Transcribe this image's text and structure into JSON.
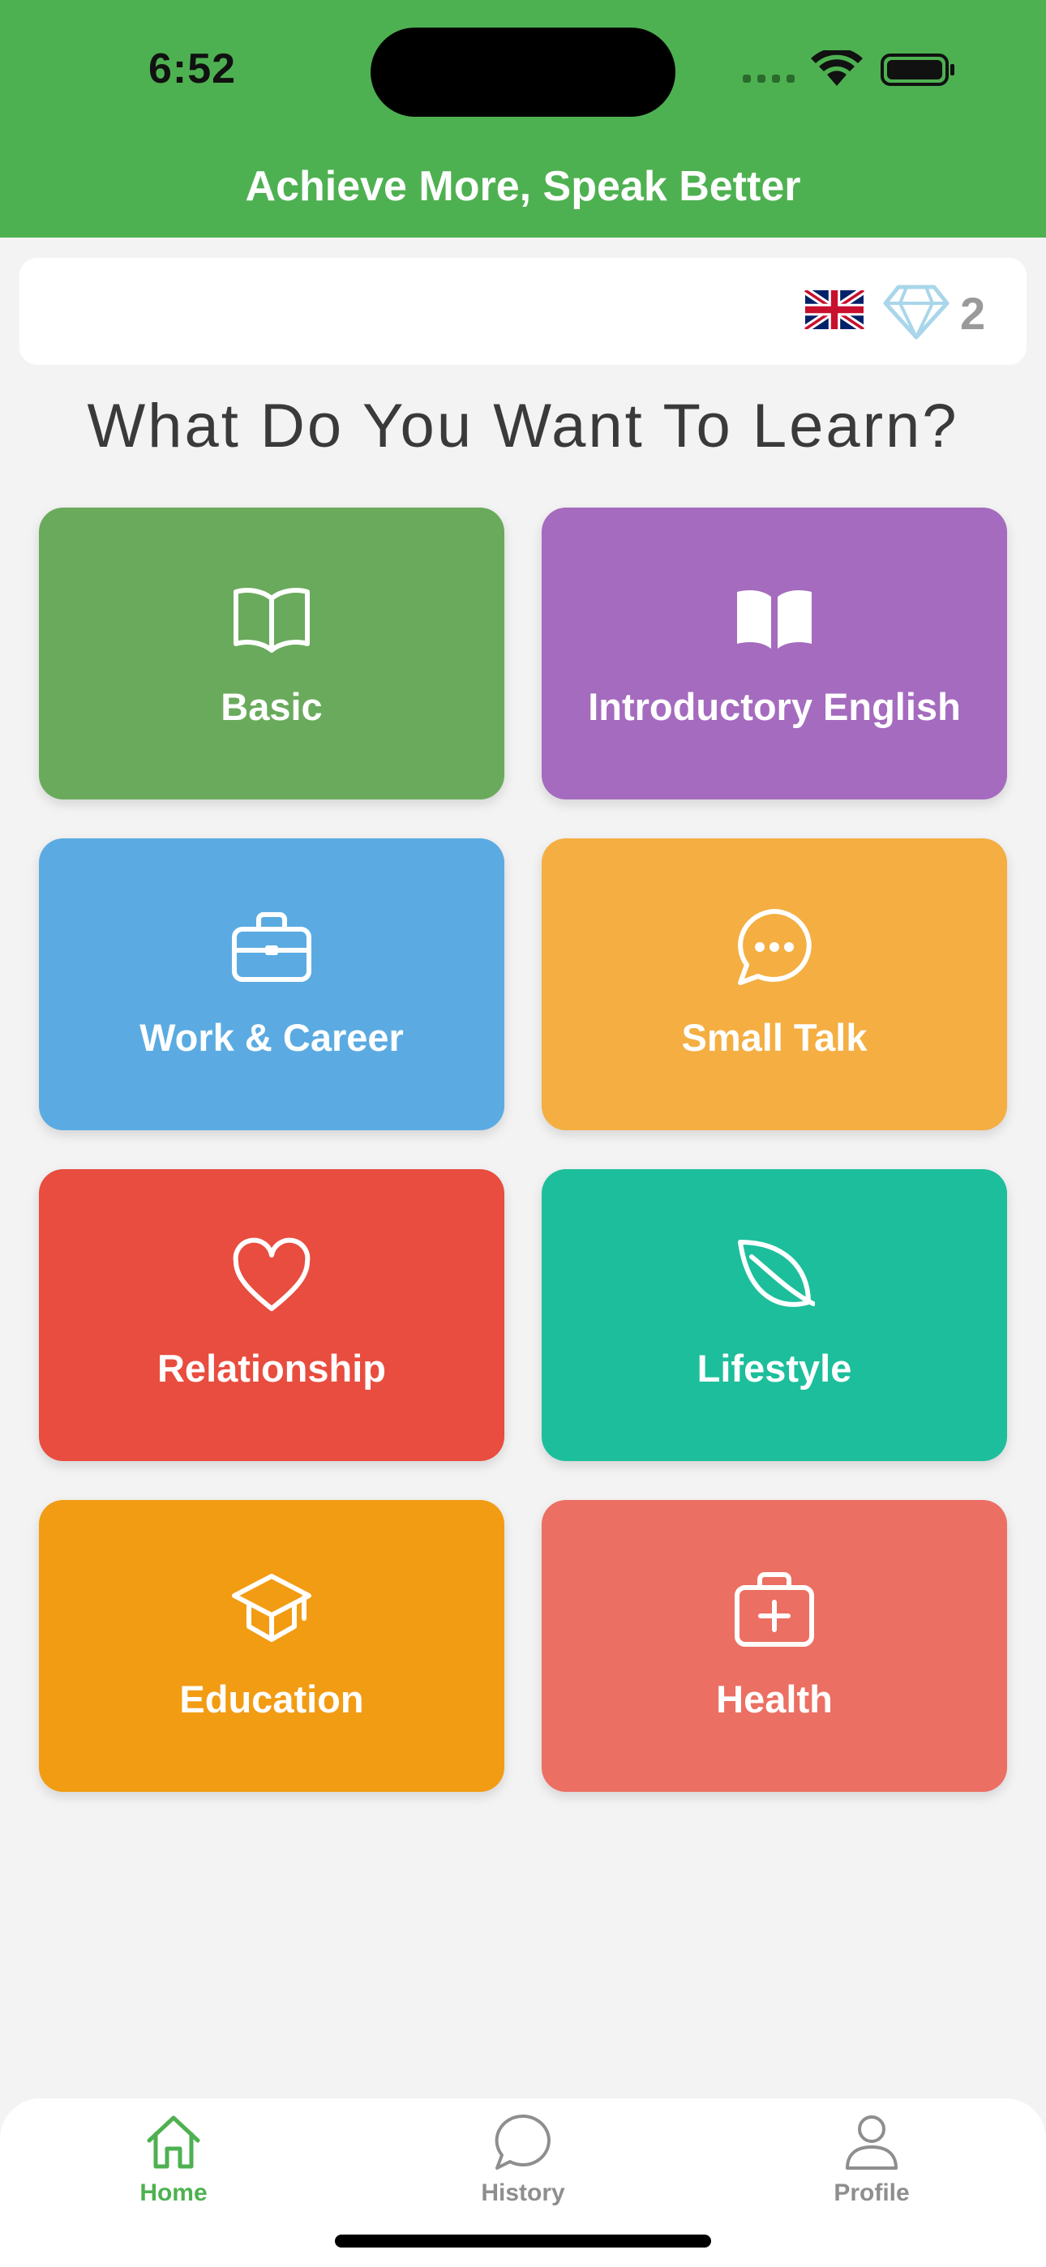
{
  "status": {
    "time": "6:52"
  },
  "header": {
    "title": "Achieve More, Speak Better"
  },
  "topbar": {
    "gem_count": "2"
  },
  "main": {
    "question": "What Do You Want To Learn?",
    "categories": [
      {
        "label": "Basic",
        "icon": "open-book-outline-icon",
        "color": "#6aaa5c"
      },
      {
        "label": "Introductory English",
        "icon": "open-book-filled-icon",
        "color": "#a56bbf"
      },
      {
        "label": "Work & Career",
        "icon": "briefcase-icon",
        "color": "#5babe2"
      },
      {
        "label": "Small Talk",
        "icon": "chat-bubble-icon",
        "color": "#f4ae42"
      },
      {
        "label": "Relationship",
        "icon": "heart-icon",
        "color": "#e84d3f"
      },
      {
        "label": "Lifestyle",
        "icon": "leaf-icon",
        "color": "#1dbe9b"
      },
      {
        "label": "Education",
        "icon": "graduation-cap-icon",
        "color": "#f29c14"
      },
      {
        "label": "Health",
        "icon": "medical-kit-icon",
        "color": "#ec6f63"
      }
    ]
  },
  "bottom_nav": {
    "items": [
      {
        "label": "Home",
        "icon": "home-icon",
        "active": true
      },
      {
        "label": "History",
        "icon": "chat-bubble-icon"
      },
      {
        "label": "Profile",
        "icon": "person-icon"
      }
    ],
    "active_color": "#4eb151",
    "inactive_color": "#8e8e8e"
  }
}
